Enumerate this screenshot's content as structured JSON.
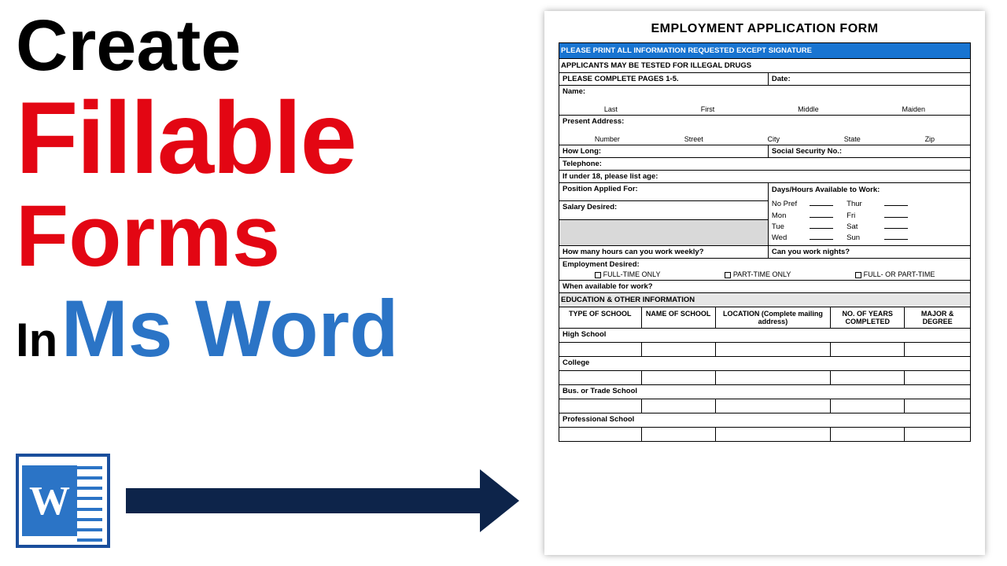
{
  "title": {
    "line1": "Create",
    "line2": "Fillable",
    "line3": "Forms",
    "line4_a": "In",
    "line4_b": "Ms Word"
  },
  "word_icon_letter": "W",
  "form": {
    "heading": "EMPLOYMENT APPLICATION FORM",
    "banner": "PLEASE PRINT ALL INFORMATION REQUESTED EXCEPT SIGNATURE",
    "drug_notice": "APPLICANTS MAY BE TESTED FOR ILLEGAL DRUGS",
    "complete_pages": "PLEASE COMPLETE PAGES 1-5.",
    "date": "Date:",
    "name": "Name:",
    "name_parts": [
      "Last",
      "First",
      "Middle",
      "Maiden"
    ],
    "address": "Present Address:",
    "address_parts": [
      "Number",
      "Street",
      "City",
      "State",
      "Zip"
    ],
    "how_long": "How Long:",
    "ssn": "Social Security No.:",
    "telephone": "Telephone:",
    "under18": "If under 18, please list age:",
    "position": "Position Applied For:",
    "days_hours": "Days/Hours Available to Work:",
    "salary": "Salary Desired:",
    "avail": {
      "nopref": "No Pref",
      "mon": "Mon",
      "tue": "Tue",
      "wed": "Wed",
      "thur": "Thur",
      "fri": "Fri",
      "sat": "Sat",
      "sun": "Sun"
    },
    "hours_weekly": "How many hours can you work weekly?",
    "work_nights": "Can you work nights?",
    "emp_desired": "Employment Desired:",
    "emp_options": [
      "FULL-TIME ONLY",
      "PART-TIME ONLY",
      "FULL- OR PART-TIME"
    ],
    "when_available": "When available for work?",
    "edu_header": "EDUCATION & OTHER INFORMATION",
    "edu_cols": [
      "TYPE OF SCHOOL",
      "NAME OF SCHOOL",
      "LOCATION (Complete mailing address)",
      "NO. OF YEARS COMPLETED",
      "MAJOR & DEGREE"
    ],
    "edu_rows": [
      "High School",
      "College",
      "Bus. or Trade School",
      "Professional School"
    ]
  }
}
